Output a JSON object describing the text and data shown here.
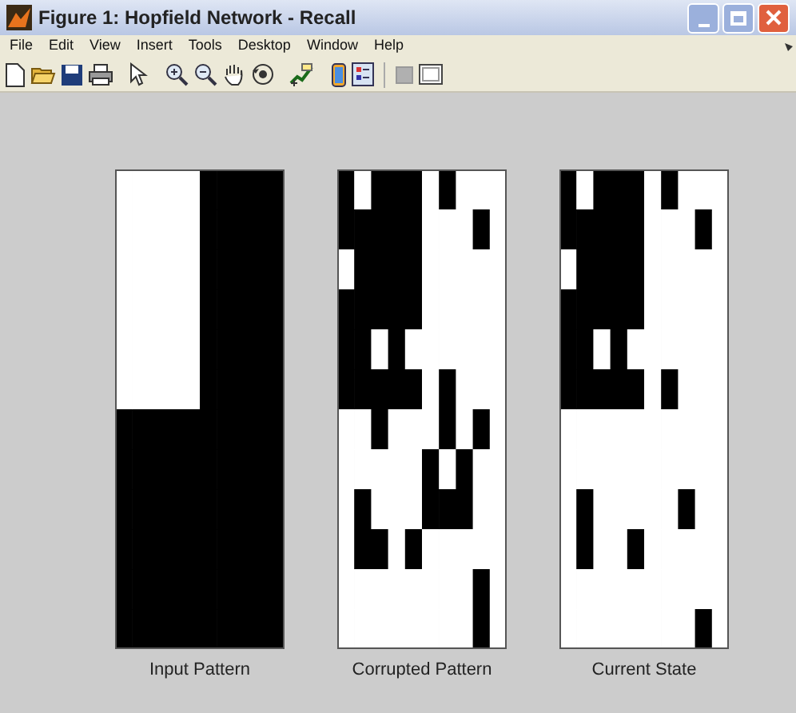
{
  "window": {
    "title": "Figure 1: Hopfield Network - Recall"
  },
  "menu": [
    "File",
    "Edit",
    "View",
    "Insert",
    "Tools",
    "Desktop",
    "Window",
    "Help"
  ],
  "panels": [
    {
      "label": "Input Pattern"
    },
    {
      "label": "Corrupted Pattern"
    },
    {
      "label": "Current State"
    }
  ]
}
